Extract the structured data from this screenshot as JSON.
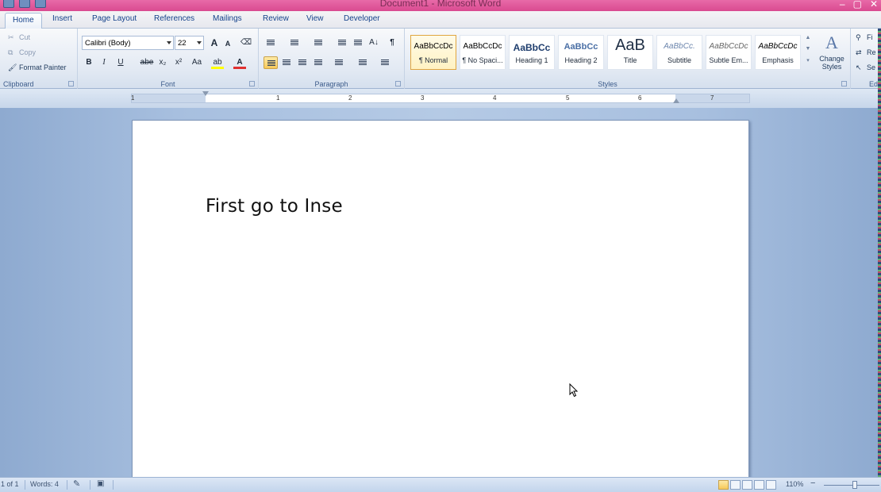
{
  "window": {
    "title": "Document1 - Microsoft Word",
    "controls": [
      "–",
      "▢",
      "✕"
    ]
  },
  "tabs": [
    "Home",
    "Insert",
    "Page Layout",
    "References",
    "Mailings",
    "Review",
    "View",
    "Developer"
  ],
  "clipboard": {
    "label": "Clipboard",
    "cut": "Cut",
    "copy": "Copy",
    "format_painter": "Format Painter"
  },
  "font": {
    "label": "Font",
    "name": "Calibri (Body)",
    "size": "22",
    "grow": "A",
    "shrink": "A",
    "bold": "B",
    "italic": "I",
    "underline": "U",
    "strike": "abe",
    "subscript": "x₂",
    "superscript": "x²",
    "change_case": "Aa",
    "highlight": "ab",
    "font_color": "A",
    "highlight_color": "#ffff00",
    "font_color_value": "#e03030"
  },
  "paragraph": {
    "label": "Paragraph",
    "show_marks": "¶",
    "sort": "A↓"
  },
  "styles": {
    "label": "Styles",
    "items": [
      {
        "sample": "AaBbCcDc",
        "name": "¶ Normal"
      },
      {
        "sample": "AaBbCcDc",
        "name": "¶ No Spaci..."
      },
      {
        "sample": "AaBbCc",
        "name": "Heading 1"
      },
      {
        "sample": "AaBbCc",
        "name": "Heading 2"
      },
      {
        "sample": "AaB",
        "name": "Title"
      },
      {
        "sample": "AaBbCc.",
        "name": "Subtitle"
      },
      {
        "sample": "AaBbCcDc",
        "name": "Subtle Em..."
      },
      {
        "sample": "AaBbCcDc",
        "name": "Emphasis"
      }
    ],
    "change_styles_line1": "Change",
    "change_styles_line2": "Styles",
    "change_styles_icon": "A"
  },
  "editing": {
    "find": "Fi",
    "replace": "Re",
    "select": "Se",
    "label": "Edi"
  },
  "ruler": {
    "numbers": [
      "1",
      "1",
      "2",
      "3",
      "4",
      "5",
      "6",
      "7"
    ]
  },
  "document": {
    "text": "First go to Inse"
  },
  "statusbar": {
    "page": "1 of 1",
    "words": "Words: 4",
    "zoom": "110%",
    "zoom_minus": "−",
    "zoom_plus": "+"
  }
}
